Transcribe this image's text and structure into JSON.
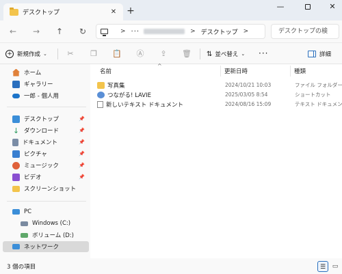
{
  "window": {
    "tab_title": "デスクトップ",
    "tab_close": "✕",
    "new_tab": "+",
    "minimize": "—",
    "close": "✕"
  },
  "nav": {
    "back": "←",
    "forward": "→",
    "up": "↑",
    "refresh": "↻",
    "breadcrumb_more": "···",
    "breadcrumb_current": "デスクトップ",
    "search_placeholder": "デスクトップの検"
  },
  "toolbar": {
    "new_label": "新規作成",
    "sort_label": "並べ替え",
    "more_label": "···",
    "details_label": "詳細",
    "icons": [
      "cut-icon",
      "copy-icon",
      "paste-icon",
      "rename-icon",
      "share-icon",
      "delete-icon"
    ]
  },
  "sidebar": {
    "quick": [
      {
        "label": "ホーム",
        "icon": "home-icon",
        "color": "#e0813a"
      },
      {
        "label": "ギャラリー",
        "icon": "gallery-icon",
        "color": "#2a6fbe"
      },
      {
        "label": "一郎 - 個人用",
        "icon": "cloud-icon",
        "color": "#1c74c9"
      }
    ],
    "pinned": [
      {
        "label": "デスクトップ",
        "icon": "desktop-icon",
        "color": "#3b8ed8"
      },
      {
        "label": "ダウンロード",
        "icon": "download-icon",
        "color": "#2c9a5e"
      },
      {
        "label": "ドキュメント",
        "icon": "documents-icon",
        "color": "#7b8da6"
      },
      {
        "label": "ピクチャ",
        "icon": "pictures-icon",
        "color": "#3a7fd0"
      },
      {
        "label": "ミュージック",
        "icon": "music-icon",
        "color": "#e0613a"
      },
      {
        "label": "ビデオ",
        "icon": "videos-icon",
        "color": "#8a4fd1"
      },
      {
        "label": "スクリーンショット",
        "icon": "folder-icon",
        "color": "#f3c44c"
      }
    ],
    "devices": [
      {
        "label": "PC",
        "icon": "pc-icon",
        "color": "#3b8ed8"
      },
      {
        "label": "Windows (C:)",
        "icon": "drive-icon",
        "color": "#7a8aa0"
      },
      {
        "label": "ボリューム (D:)",
        "icon": "drive-icon",
        "color": "#5fa86a"
      },
      {
        "label": "ネットワーク",
        "icon": "network-icon",
        "color": "#3b8ed8"
      }
    ],
    "pin_glyph": "📌"
  },
  "list": {
    "sort_arrow": "^",
    "columns": {
      "name": "名前",
      "date": "更新日時",
      "type": "種類"
    },
    "rows": [
      {
        "name": "写真集",
        "date": "2024/10/21 10:03",
        "type": "ファイル フォルダー",
        "icon": "folder-icon",
        "color": "#f3c44c"
      },
      {
        "name": "つながる! LAVIE",
        "date": "2025/03/05 8:54",
        "type": "ショートカット",
        "icon": "shortcut-icon",
        "color": "#5a8fd6"
      },
      {
        "name": "新しいテキスト ドキュメント",
        "date": "2024/08/16 15:09",
        "type": "テキスト ドキュメント",
        "icon": "text-file-icon",
        "color": "#ffffff"
      }
    ]
  },
  "status": {
    "item_count": "3 個の項目"
  }
}
